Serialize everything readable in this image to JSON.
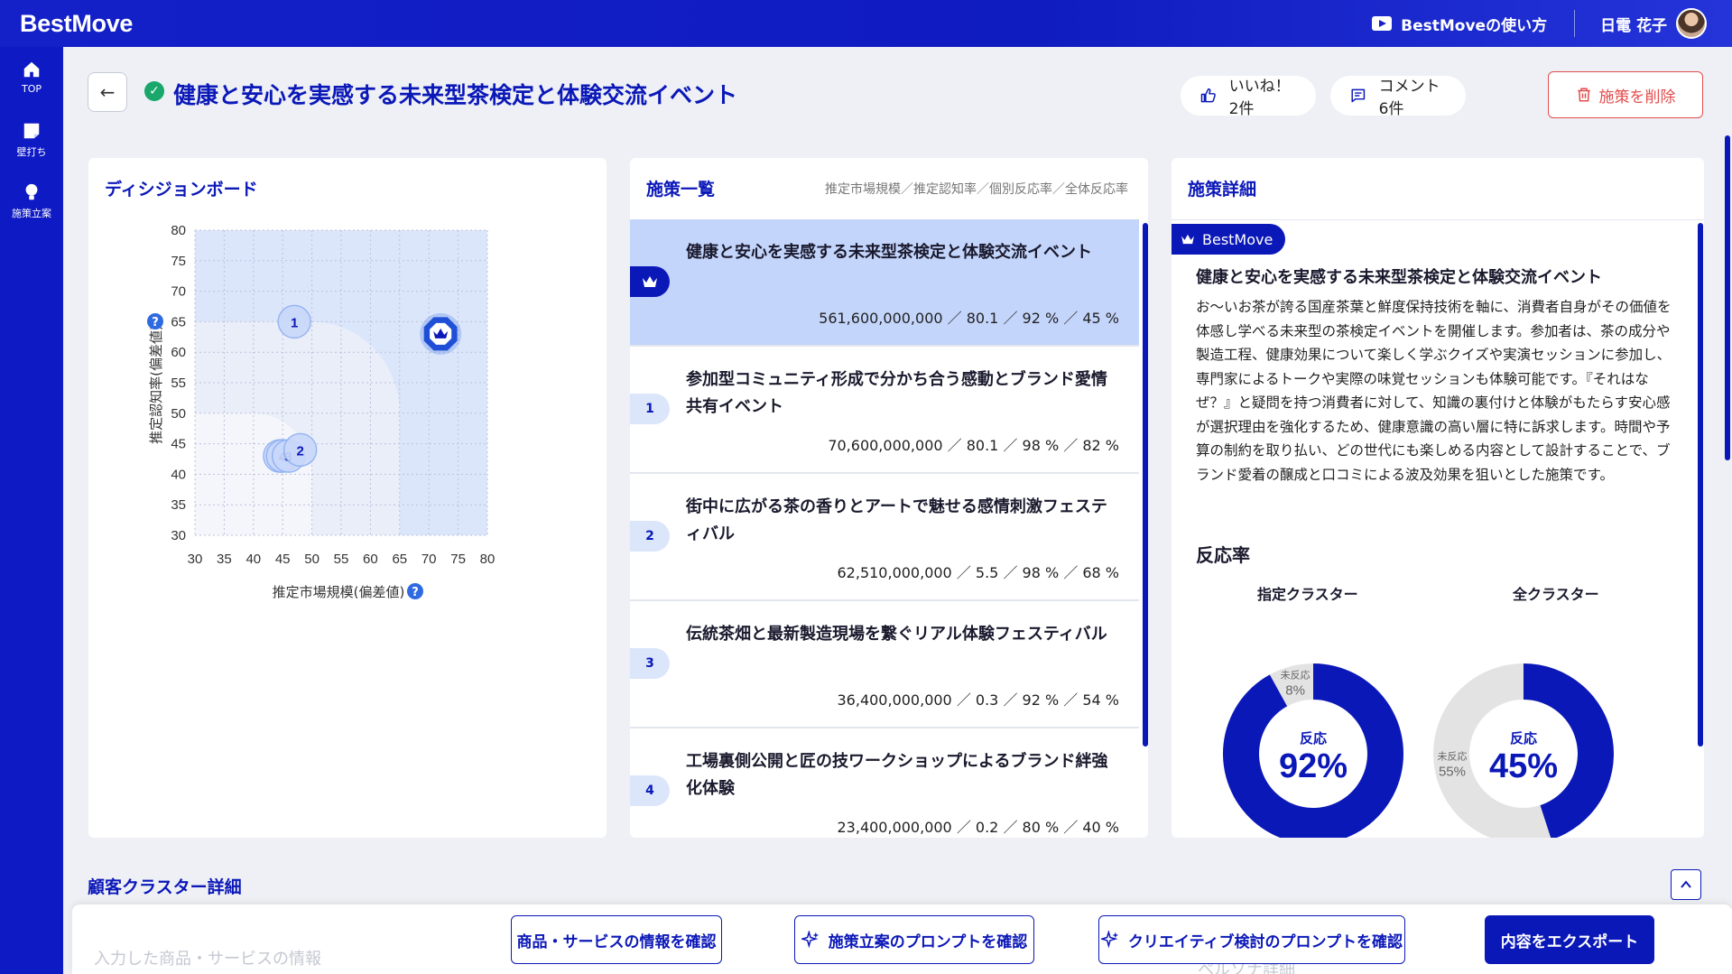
{
  "header": {
    "brand": "BestMove",
    "howto_label": "BestMoveの使い方",
    "user_name": "日電 花子"
  },
  "sidebar": {
    "items": [
      {
        "label": "TOP",
        "icon": "home-icon"
      },
      {
        "label": "壁打ち",
        "icon": "chat-icon"
      },
      {
        "label": "施策立案",
        "icon": "lightbulb-icon"
      }
    ]
  },
  "page": {
    "title": "健康と安心を実感する未来型茶検定と体験交流イベント",
    "like_label": "いいね！ 2件",
    "comment_label": "コメント 6件",
    "delete_label": "施策を削除"
  },
  "decision_board": {
    "title": "ディシジョンボード"
  },
  "chart_data": {
    "type": "scatter",
    "xlabel": "推定市場規模(偏差値)",
    "ylabel": "推定認知率(偏差値)",
    "xlim": [
      30,
      80
    ],
    "ylim": [
      30,
      80
    ],
    "x_ticks": [
      30,
      35,
      40,
      45,
      50,
      55,
      60,
      65,
      70,
      75,
      80
    ],
    "y_ticks": [
      30,
      35,
      40,
      45,
      50,
      55,
      60,
      65,
      70,
      75,
      80
    ],
    "grid": true,
    "points": [
      {
        "label": "BestMove",
        "x": 72,
        "y": 63,
        "crown": true
      },
      {
        "label": "1",
        "x": 47,
        "y": 65
      },
      {
        "label": "2",
        "x": 48,
        "y": 44
      },
      {
        "label": "3",
        "x": 46,
        "y": 43
      },
      {
        "label": "4",
        "x": 45,
        "y": 43
      },
      {
        "label": "5",
        "x": 44.5,
        "y": 43
      }
    ]
  },
  "measures": {
    "title": "施策一覧",
    "subtitle": "推定市場規模／推定認知率／個別反応率／全体反応率",
    "items": [
      {
        "badge": "",
        "crown": true,
        "title": "健康と安心を実感する未来型茶検定と体験交流イベント",
        "values": "561,600,000,000 ／ 80.1 ／ 92 % ／ 45 %",
        "active": true
      },
      {
        "badge": "1",
        "title": "参加型コミュニティ形成で分かち合う感動とブランド愛情共有イベント",
        "values": "70,600,000,000 ／ 80.1 ／ 98 % ／ 82 %"
      },
      {
        "badge": "2",
        "title": "街中に広がる茶の香りとアートで魅せる感情刺激フェスティバル",
        "values": "62,510,000,000 ／ 5.5 ／ 98 % ／ 68 %"
      },
      {
        "badge": "3",
        "title": "伝統茶畑と最新製造現場を繋ぐリアル体験フェスティバル",
        "values": "36,400,000,000 ／ 0.3 ／ 92 % ／ 54 %"
      },
      {
        "badge": "4",
        "title": "工場裏側公開と匠の技ワークショップによるブランド絆強化体験",
        "values": "23,400,000,000 ／ 0.2 ／ 80 % ／ 40 %"
      }
    ]
  },
  "detail": {
    "title": "施策詳細",
    "tag": "BestMove",
    "measure_title": "健康と安心を実感する未来型茶検定と体験交流イベント",
    "body": "お〜いお茶が誇る国産茶葉と鮮度保持技術を軸に、消費者自身がその価値を体感し学べる未来型の茶検定イベントを開催します。参加者は、茶の成分や製造工程、健康効果について楽しく学ぶクイズや実演セッションに参加し、専門家によるトークや実際の味覚セッションも体験可能です。『それはなぜ？』と疑問を持つ消費者に対して、知識の裏付けと体験がもたらす安心感が選択理由を強化するため、健康意識の高い層に特に訴求します。時間や予算の制約を取り払い、どの世代にも楽しめる内容として設計することで、ブランド愛着の醸成と口コミによる波及効果を狙いとした施策です。",
    "response_heading": "反応率",
    "donuts": [
      {
        "label": "指定クラスター",
        "response_label": "反応",
        "response_pct": 92,
        "response_text": "92%",
        "no_response_label": "未反応",
        "no_response_text": "8%"
      },
      {
        "label": "全クラスター",
        "response_label": "反応",
        "response_pct": 45,
        "response_text": "45%",
        "no_response_label": "未反応",
        "no_response_text": "55%"
      }
    ]
  },
  "bottom": {
    "cluster_title": "顧客クラスター詳細",
    "faded_left": "入力した商品・サービスの情報",
    "faded_right": "ペルソナ詳細",
    "btn_product": "商品・サービスの情報を確認",
    "btn_plan_prompt": "施策立案のプロンプトを確認",
    "btn_creative_prompt": "クリエイティブ検討のプロンプトを確認",
    "btn_export": "内容をエクスポート"
  },
  "colors": {
    "primary": "#0b18b8",
    "active_row": "#c4d5fb",
    "danger": "#e34c4c",
    "success": "#19a76b",
    "donut_empty": "#e3e3e3"
  }
}
